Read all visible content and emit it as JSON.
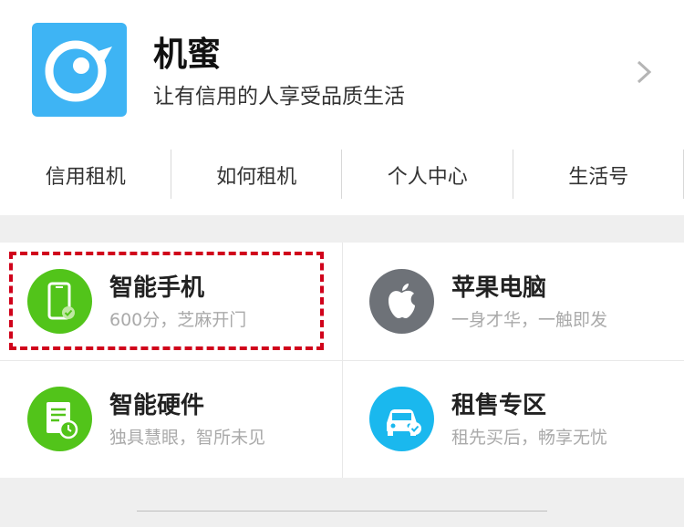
{
  "header": {
    "title": "机蜜",
    "subtitle": "让有信用的人享受品质生活",
    "logo_icon": "bird-eye-logo",
    "accent_color": "#3eb4f4"
  },
  "nav": {
    "items": [
      {
        "label": "信用租机"
      },
      {
        "label": "如何租机"
      },
      {
        "label": "个人中心"
      },
      {
        "label": "生活号"
      }
    ]
  },
  "categories": [
    {
      "title": "智能手机",
      "subtitle": "600分，芝麻开门",
      "icon": "phone-icon",
      "color": "#52c41a"
    },
    {
      "title": "苹果电脑",
      "subtitle": "一身才华，一触即发",
      "icon": "apple-icon",
      "color": "#6e7278"
    },
    {
      "title": "智能硬件",
      "subtitle": "独具慧眼，智所未见",
      "icon": "document-clock-icon",
      "color": "#52c41a"
    },
    {
      "title": "租售专区",
      "subtitle": "租先买后，畅享无忧",
      "icon": "car-icon",
      "color": "#1ab8ee"
    }
  ],
  "highlight_color": "#d0021b"
}
